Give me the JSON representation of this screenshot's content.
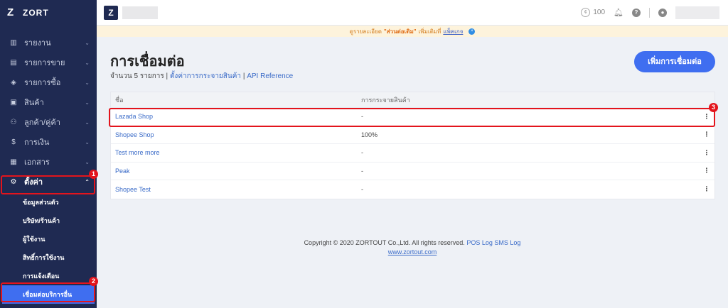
{
  "brand": {
    "name": "ZORT",
    "logo": "Z"
  },
  "sidebar": {
    "items": [
      {
        "icon": "chart-icon",
        "glyph": "▥",
        "label": "รายงาน"
      },
      {
        "icon": "clipboard-icon",
        "glyph": "▤",
        "label": "รายการขาย"
      },
      {
        "icon": "basket-icon",
        "glyph": "◈",
        "label": "รายการซื้อ"
      },
      {
        "icon": "box-icon",
        "glyph": "▣",
        "label": "สินค้า"
      },
      {
        "icon": "users-icon",
        "glyph": "⚇",
        "label": "ลูกค้า/คู่ค้า"
      },
      {
        "icon": "money-icon",
        "glyph": "$",
        "label": "การเงิน"
      },
      {
        "icon": "document-icon",
        "glyph": "▦",
        "label": "เอกสาร"
      },
      {
        "icon": "gear-icon",
        "glyph": "⚙",
        "label": "ตั้งค่า"
      }
    ],
    "sub_items": [
      "ข้อมูลส่วนตัว",
      "บริษัท/ร้านค้า",
      "ผู้ใช้งาน",
      "สิทธิ์การใช้งาน",
      "การแจ้งเตือน",
      "เชื่อมต่อบริการอื่น"
    ],
    "badges": {
      "settings": "1",
      "connect": "2"
    }
  },
  "topbar": {
    "credits": "100"
  },
  "notice": {
    "prefix": "ดูรายละเอียด",
    "highlight": "\"ส่วนต่อเติม\"",
    "middle": "เพิ่มเติมที่",
    "link": "แพ็คเกจ",
    "close": "×"
  },
  "page": {
    "title": "การเชื่อมต่อ",
    "count_text": "จำนวน 5 รายการ",
    "sep1": " | ",
    "link_distribution": "ตั้งค่าการกระจายสินค้า",
    "sep2": " | ",
    "link_api": "API Reference",
    "add_button": "เพิ่มการเชื่อมต่อ"
  },
  "table": {
    "headers": {
      "name": "ชื่อ",
      "distribution": "การกระจายสินค้า"
    },
    "rows": [
      {
        "name": "Lazada Shop",
        "distribution": "-"
      },
      {
        "name": "Shopee Shop",
        "distribution": "100%"
      },
      {
        "name": "Test more more",
        "distribution": "-"
      },
      {
        "name": "Peak",
        "distribution": "-"
      },
      {
        "name": "Shopee Test",
        "distribution": "-"
      }
    ],
    "row_badge": "3",
    "row_menu": "⋮"
  },
  "footer": {
    "copyright": "Copyright © 2020 ZORTOUT Co.,Ltd. All rights reserved.",
    "link_pos": "POS",
    "link_log": "Log",
    "link_sms": "SMS Log",
    "site": "www.zortout.com"
  },
  "colors": {
    "sidebar": "#1f2a52",
    "accent": "#3f6ef0",
    "highlight": "#e3141c"
  }
}
